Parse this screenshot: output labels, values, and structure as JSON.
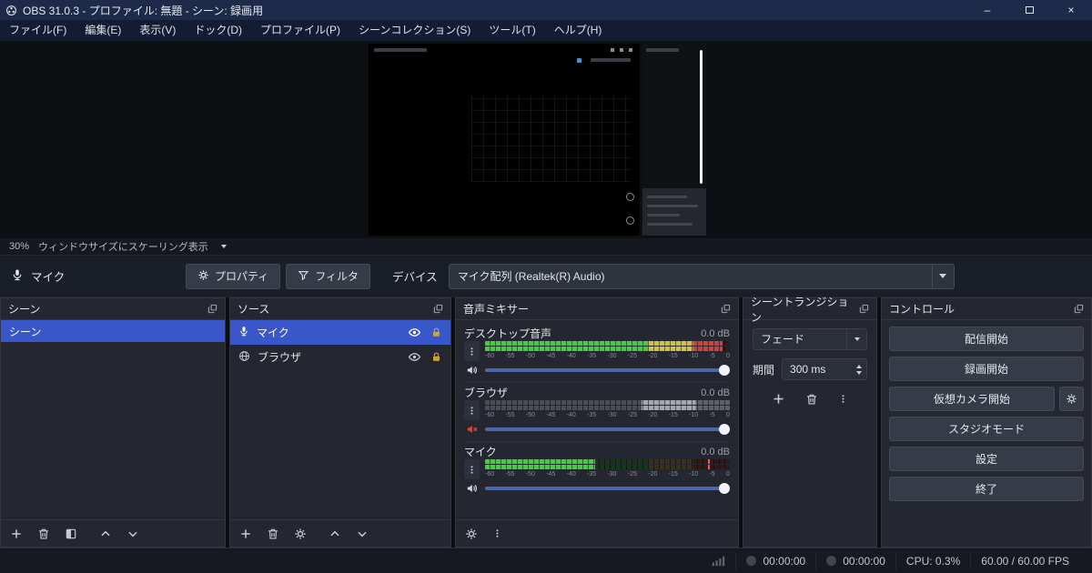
{
  "window": {
    "title": "OBS 31.0.3 - プロファイル: 無題 - シーン: 録画用",
    "controls": {
      "minimize": "–",
      "close": "×"
    }
  },
  "menu": {
    "items": [
      "ファイル(F)",
      "編集(E)",
      "表示(V)",
      "ドック(D)",
      "プロファイル(P)",
      "シーンコレクション(S)",
      "ツール(T)",
      "ヘルプ(H)"
    ]
  },
  "preview": {
    "zoom": "30%",
    "scaling_label": "ウィンドウサイズにスケーリング表示"
  },
  "context": {
    "source_name": "マイク",
    "properties_label": "プロパティ",
    "filters_label": "フィルタ",
    "device_label": "デバイス",
    "device_value": "マイク配列 (Realtek(R) Audio)"
  },
  "scenes": {
    "title": "シーン",
    "items": [
      {
        "name": "シーン",
        "selected": true
      }
    ]
  },
  "sources": {
    "title": "ソース",
    "items": [
      {
        "name": "マイク",
        "icon": "mic-icon",
        "selected": true
      },
      {
        "name": "ブラウザ",
        "icon": "globe-icon",
        "selected": false
      }
    ]
  },
  "mixer": {
    "title": "音声ミキサー",
    "scale": [
      "-60",
      "-55",
      "-50",
      "-45",
      "-40",
      "-35",
      "-30",
      "-25",
      "-20",
      "-15",
      "-10",
      "-5",
      "0"
    ],
    "channels": [
      {
        "name": "デスクトップ音声",
        "db": "0.0 dB",
        "muted": false,
        "cover_pct": 3
      },
      {
        "name": "ブラウザ",
        "db": "0.0 dB",
        "muted": true,
        "cover_pct": 0
      },
      {
        "name": "マイク",
        "db": "0.0 dB",
        "muted": false,
        "cover_pct": 55,
        "peak_pct": 91
      }
    ]
  },
  "transitions": {
    "title": "シーントランジション",
    "transition_value": "フェード",
    "duration_label": "期間",
    "duration_value": "300 ms"
  },
  "controls_panel": {
    "title": "コントロール",
    "buttons": [
      "配信開始",
      "録画開始",
      "仮想カメラ開始",
      "スタジオモード",
      "設定",
      "終了"
    ]
  },
  "statusbar": {
    "rec_time": "00:00:00",
    "stream_time": "00:00:00",
    "cpu": "CPU: 0.3%",
    "fps": "60.00 / 60.00 FPS"
  },
  "colors": {
    "accent_blue": "#3a57c9",
    "titlebar": "#1d2a4a",
    "meter_green": "#3fd23f",
    "meter_yellow": "#d2c33f",
    "meter_red": "#d23f3f",
    "slider_blue": "#4d66a8",
    "mute_red": "#e04545"
  }
}
